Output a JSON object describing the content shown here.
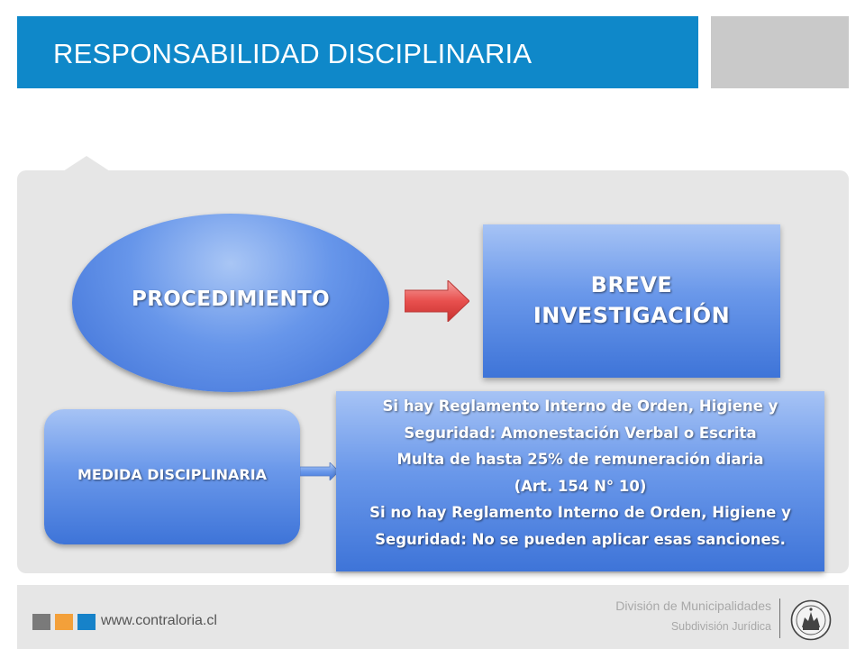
{
  "title": "RESPONSABILIDAD DISCIPLINARIA",
  "diagram": {
    "procedimiento": "PROCEDIMIENTO",
    "breve_investigacion": [
      "BREVE",
      "INVESTIGACIÓN"
    ],
    "medida": "MEDIDA DISCIPLINARIA",
    "info_lines": [
      "Si hay Reglamento Interno de Orden, Higiene y",
      "Seguridad: Amonestación Verbal o Escrita",
      "Multa de hasta 25% de remuneración diaria",
      "(Art. 154 N° 10)",
      "Si no hay Reglamento Interno de Orden, Higiene y",
      "Seguridad: No se pueden aplicar esas sanciones."
    ]
  },
  "footer": {
    "url": "www.contraloria.cl",
    "division": "División de Municipalidades",
    "subdivision": "Subdivisión Jurídica"
  },
  "colors": {
    "title_bar": "#0f88c9",
    "panel": "#e6e6e6",
    "shape_blue": "#6a98ea",
    "arrow_red": "#e8504e",
    "square_gray": "#7a7a7a",
    "square_orange": "#f3a03a",
    "square_blue": "#1682c9"
  },
  "icons": {
    "right_arrow": "right-arrow-icon",
    "small_arrow": "small-right-arrow-icon",
    "seal": "contraloria-seal-icon"
  }
}
